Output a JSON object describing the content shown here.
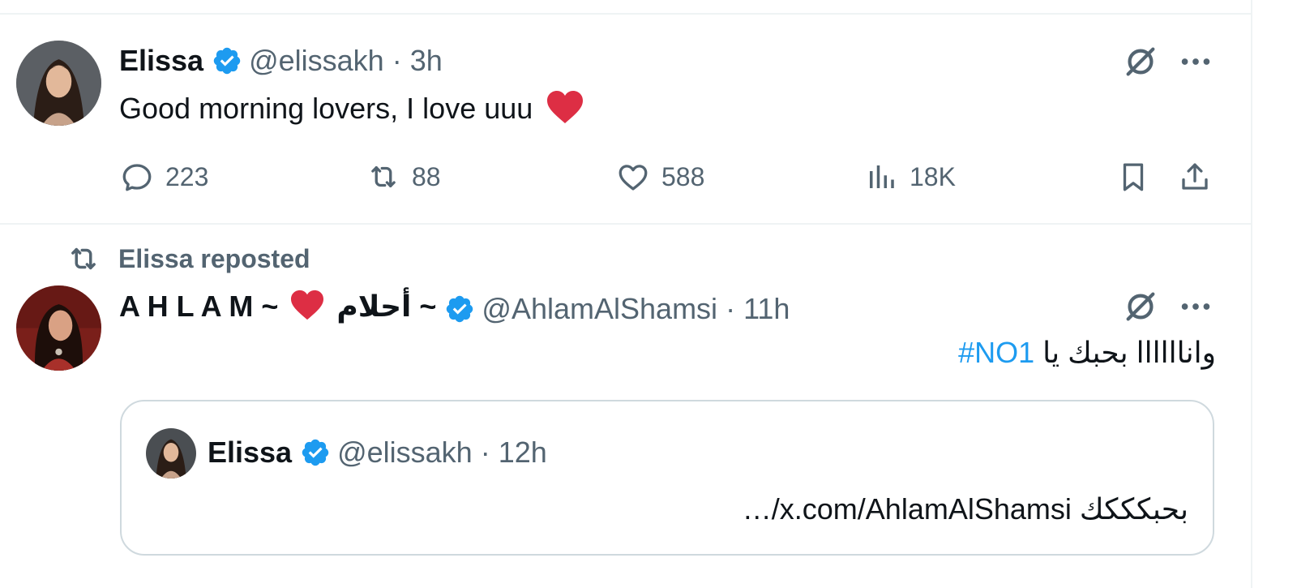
{
  "tweet1": {
    "display_name": "Elissa",
    "handle": "@elissakh",
    "dot": "·",
    "time": "3h",
    "text": "Good morning lovers, I love uuu",
    "emoji": "❤️",
    "stats": {
      "replies": "223",
      "reposts": "88",
      "likes": "588",
      "views": "18K"
    }
  },
  "repost_context": {
    "label": "Elissa reposted"
  },
  "tweet2": {
    "display_name_prefix": "A H L A M ~",
    "display_name_suffix": "~ أحلام",
    "heart": "❤️",
    "handle": "@AhlamAlShamsi",
    "dot": "·",
    "time": "11h",
    "text": "واناااااا بحبك يا",
    "hashtag": "#NO1",
    "quote": {
      "display_name": "Elissa",
      "handle": "@elissakh",
      "dot": "·",
      "time": "12h",
      "text": "بحبكككك x.com/AhlamAlShamsi/…"
    }
  },
  "colors": {
    "accent": "#1d9bf0",
    "heart": "#f91880",
    "muted": "#536471",
    "border": "#eff3f4"
  }
}
